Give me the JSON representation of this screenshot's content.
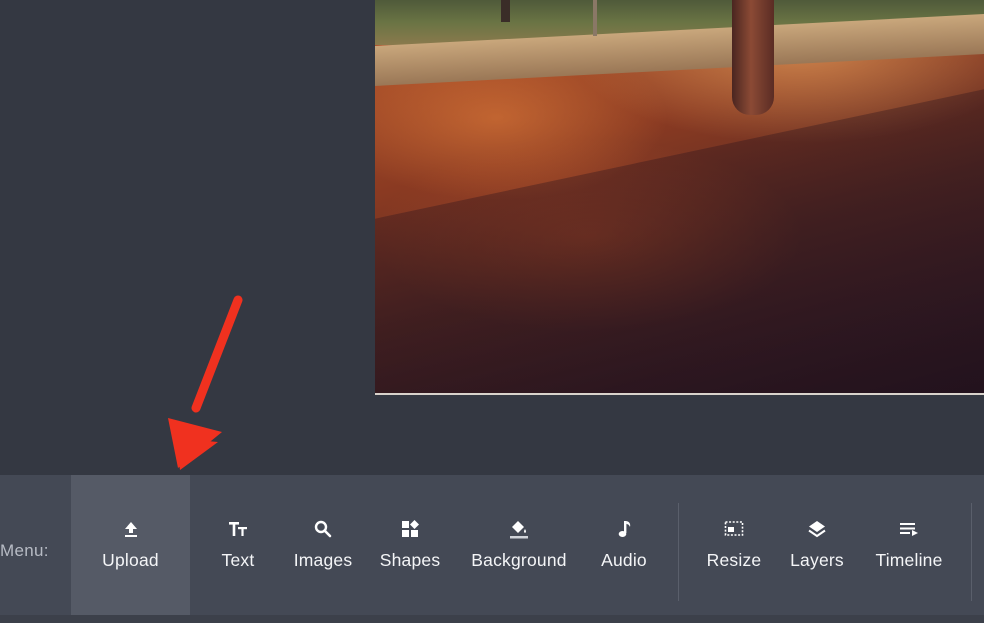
{
  "toolbar": {
    "menu_label": "Menu:",
    "items": [
      {
        "label": "Upload",
        "icon": "upload-icon",
        "active": true
      },
      {
        "label": "Text",
        "icon": "text-size-icon",
        "active": false
      },
      {
        "label": "Images",
        "icon": "search-icon",
        "active": false
      },
      {
        "label": "Shapes",
        "icon": "shapes-icon",
        "active": false
      },
      {
        "label": "Background",
        "icon": "paint-bucket-icon",
        "active": false
      },
      {
        "label": "Audio",
        "icon": "music-note-icon",
        "active": false
      },
      {
        "label": "Resize",
        "icon": "resize-icon",
        "active": false
      },
      {
        "label": "Layers",
        "icon": "layers-icon",
        "active": false
      },
      {
        "label": "Timeline",
        "icon": "timeline-icon",
        "active": false
      }
    ]
  },
  "colors": {
    "page_background": "#343842",
    "toolbar_background": "#444955",
    "active_tool_background": "#555a66",
    "annotation_arrow": "#f0311f"
  }
}
